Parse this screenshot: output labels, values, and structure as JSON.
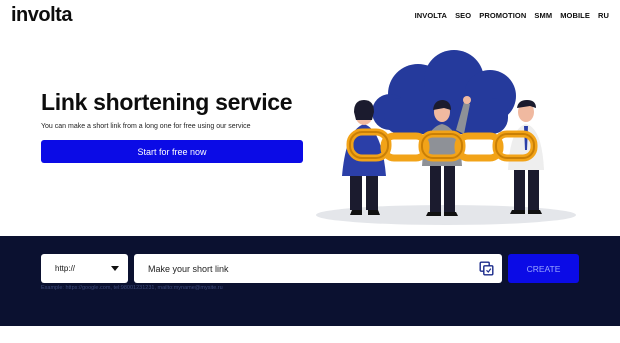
{
  "header": {
    "logo": "involta",
    "nav": [
      "INVOLTA",
      "SEO",
      "PROMOTION",
      "SMM",
      "MOBILE",
      "RU"
    ]
  },
  "hero": {
    "title": "Link shortening service",
    "subtitle": "You can make a short link from a long one for free using our service",
    "cta_label": "Start for free now"
  },
  "shortener": {
    "protocol": "http://",
    "input_placeholder": "Make your short link",
    "create_label": "CREATE",
    "example": "Example: https://google.com, tel:98001231231, mailto:myname@mysite.ru"
  },
  "colors": {
    "accent": "#0b0be6",
    "band": "#0b1130",
    "cloud": "#253a9c",
    "chain": "#f2a318"
  }
}
